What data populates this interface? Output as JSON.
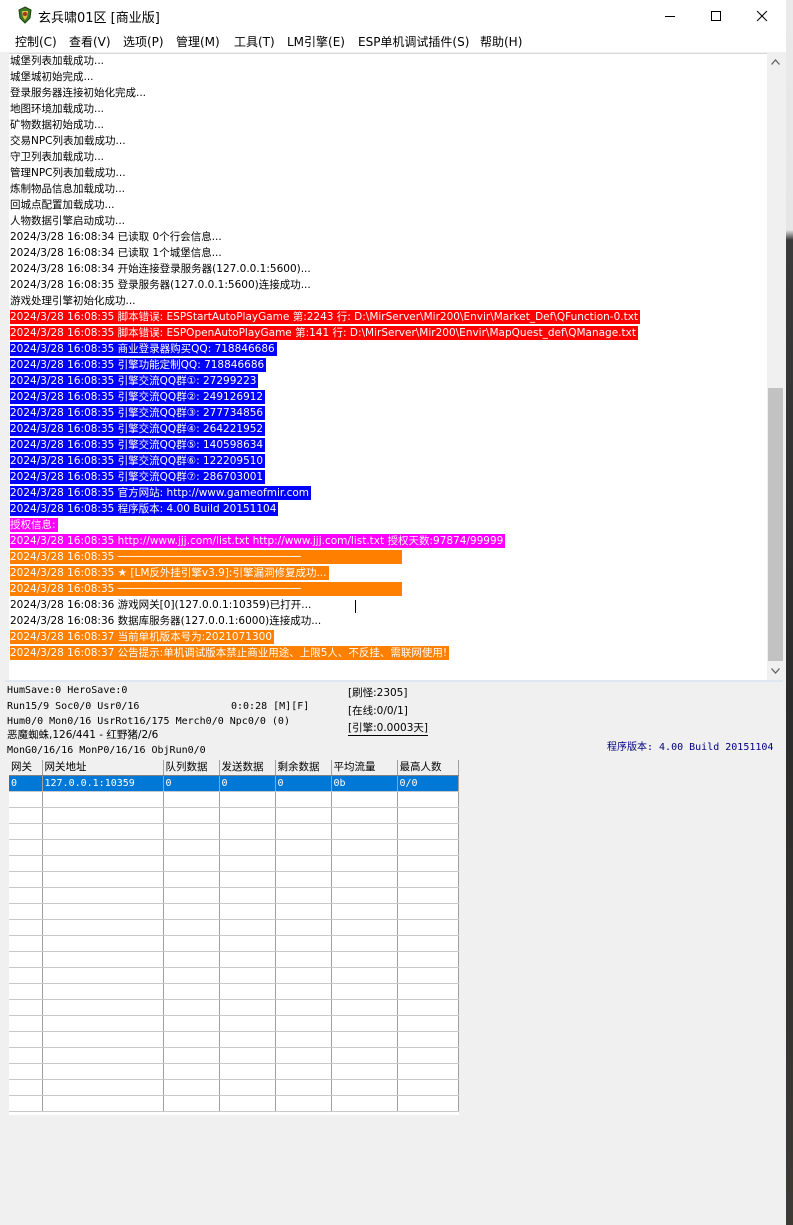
{
  "window": {
    "title": "玄兵啸01区 [商业版]"
  },
  "menu": [
    "控制(C)",
    "查看(V)",
    "选项(P)",
    "管理(M)",
    "工具(T)",
    "LM引擎(E)",
    "ESP单机调试插件(S)",
    "帮助(H)"
  ],
  "log": [
    {
      "text": "城堡列表加载成功...",
      "style": "plain"
    },
    {
      "text": "城堡城初始完成...",
      "style": "plain"
    },
    {
      "text": "登录服务器连接初始化完成...",
      "style": "plain"
    },
    {
      "text": "地图环境加载成功...",
      "style": "plain"
    },
    {
      "text": "矿物数据初始成功...",
      "style": "plain"
    },
    {
      "text": "交易NPC列表加载成功...",
      "style": "plain"
    },
    {
      "text": "守卫列表加载成功...",
      "style": "plain"
    },
    {
      "text": "管理NPC列表加载成功...",
      "style": "plain"
    },
    {
      "text": "炼制物品信息加载成功...",
      "style": "plain"
    },
    {
      "text": "回城点配置加载成功...",
      "style": "plain"
    },
    {
      "text": "人物数据引擎启动成功...",
      "style": "plain"
    },
    {
      "text": "2024/3/28 16:08:34 已读取 0个行会信息...",
      "style": "plain"
    },
    {
      "text": "2024/3/28 16:08:34 已读取 1个城堡信息...",
      "style": "plain"
    },
    {
      "text": "2024/3/28 16:08:34 开始连接登录服务器(127.0.0.1:5600)...",
      "style": "plain"
    },
    {
      "text": "2024/3/28 16:08:35 登录服务器(127.0.0.1:5600)连接成功...",
      "style": "plain"
    },
    {
      "text": "游戏处理引擎初始化成功...",
      "style": "plain"
    },
    {
      "text": "2024/3/28 16:08:35 脚本错误: ESPStartAutoPlayGame 第:2243 行: D:\\MirServer\\Mir200\\Envir\\Market_Def\\QFunction-0.txt",
      "style": "red"
    },
    {
      "text": "2024/3/28 16:08:35 脚本错误: ESPOpenAutoPlayGame 第:141 行: D:\\MirServer\\Mir200\\Envir\\MapQuest_def\\QManage.txt",
      "style": "red"
    },
    {
      "text": "2024/3/28 16:08:35 商业登录器购买QQ: 718846686",
      "style": "blue"
    },
    {
      "text": "2024/3/28 16:08:35 引擎功能定制QQ: 718846686",
      "style": "blue"
    },
    {
      "text": "2024/3/28 16:08:35 引擎交流QQ群①: 27299223",
      "style": "blue"
    },
    {
      "text": "2024/3/28 16:08:35 引擎交流QQ群②: 249126912",
      "style": "blue"
    },
    {
      "text": "2024/3/28 16:08:35 引擎交流QQ群③: 277734856",
      "style": "blue"
    },
    {
      "text": "2024/3/28 16:08:35 引擎交流QQ群④: 264221952",
      "style": "blue"
    },
    {
      "text": "2024/3/28 16:08:35 引擎交流QQ群⑤: 140598634",
      "style": "blue"
    },
    {
      "text": "2024/3/28 16:08:35 引擎交流QQ群⑥: 122209510",
      "style": "blue"
    },
    {
      "text": "2024/3/28 16:08:35 引擎交流QQ群⑦: 286703001",
      "style": "blue"
    },
    {
      "text": "2024/3/28 16:08:35 官方网站: http://www.gameofmir.com",
      "style": "blue"
    },
    {
      "text": "2024/3/28 16:08:35 程序版本: 4.00 Build 20151104",
      "style": "blue"
    },
    {
      "text": "授权信息:",
      "style": "magenta"
    },
    {
      "text": "2024/3/28 16:08:35 http://www.jjj.com/list.txt http://www.jjj.com/list.txt 授权天数:97874/99999",
      "style": "magenta"
    },
    {
      "text": "2024/3/28 16:08:35 ─────────────────────────────",
      "style": "sep"
    },
    {
      "text": "2024/3/28 16:08:35 ★ [LM反外挂引擎v3.9]:引擎漏洞修复成功...",
      "style": "orange"
    },
    {
      "text": "2024/3/28 16:08:35 ─────────────────────────────",
      "style": "sep"
    },
    {
      "text": "2024/3/28 16:08:36 游戏网关[0](127.0.0.1:10359)已打开...",
      "style": "plain"
    },
    {
      "text": "2024/3/28 16:08:36 数据库服务器(127.0.0.1:6000)连接成功...",
      "style": "plain"
    },
    {
      "text": "2024/3/28 16:08:37 当前单机版本号为:2021071300",
      "style": "orange"
    },
    {
      "text": "2024/3/28 16:08:37 公告提示:单机调试版本禁止商业用途、上限5人、不反挂、需联网使用!",
      "style": "orange"
    }
  ],
  "status": {
    "line1": "HumSave:0 HeroSave:0",
    "line2": "Run15/9 Soc0/0 Usr0/16",
    "timer": "0:0:28 [M][F]",
    "line3": "Hum0/0 Mon0/16 UsrRot16/175 Merch0/0 Npc0/0 (0)",
    "line4": "恶魔蜘蛛,126/441 - 红野猪/2/6",
    "line5": "MonG0/16/16 MonP0/16/16 ObjRun0/0",
    "refresh": "[刷怪:2305]",
    "online": "[在线:0/0/1]",
    "engine": "[引擎:0.0003天]",
    "version": "程序版本: 4.00 Build 20151104"
  },
  "gateway_table": {
    "headers": [
      "网关",
      "网关地址",
      "队列数据",
      "发送数据",
      "剩余数据",
      "平均流量",
      "最高人数"
    ],
    "rows": [
      [
        "0",
        "127.0.0.1:10359",
        "0",
        "0",
        "0",
        "0b",
        "0/0"
      ]
    ]
  },
  "colors": {
    "red": "#ff0000",
    "blue": "#0000ff",
    "magenta": "#ff00ff",
    "orange": "#ff7f00",
    "selection": "#0078d7",
    "version_text": "#000080"
  },
  "icons": {
    "app": "app-icon",
    "minimize": "minimize-icon",
    "maximize": "maximize-icon",
    "close": "close-icon"
  }
}
